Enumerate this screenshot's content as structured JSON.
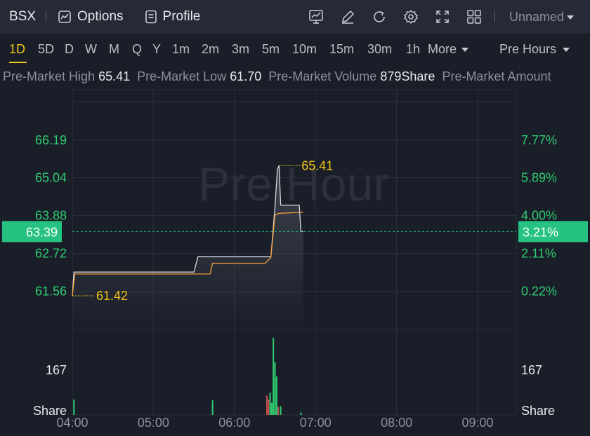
{
  "header": {
    "ticker": "BSX",
    "options_label": "Options",
    "profile_label": "Profile",
    "layout_name": "Unnamed"
  },
  "periods": [
    {
      "label": "1D",
      "active": true
    },
    {
      "label": "5D"
    },
    {
      "label": "D"
    },
    {
      "label": "W"
    },
    {
      "label": "M"
    },
    {
      "label": "Q"
    },
    {
      "label": "Y"
    },
    {
      "label": "1m"
    },
    {
      "label": "2m"
    },
    {
      "label": "3m"
    },
    {
      "label": "5m"
    },
    {
      "label": "10m"
    },
    {
      "label": "15m"
    },
    {
      "label": "30m"
    },
    {
      "label": "1h"
    }
  ],
  "more_label": "More",
  "session_label": "Pre Hours",
  "stats": {
    "high_label": "Pre-Market High",
    "high_value": "65.41",
    "low_label": "Pre-Market Low",
    "low_value": "61.70",
    "volume_label": "Pre-Market Volume",
    "volume_value": "879",
    "volume_unit": "Share",
    "amount_label": "Pre-Market Amount"
  },
  "watermark": "Pre Hour",
  "colors": {
    "up": "#2ecc71",
    "highlight": "#f5c518",
    "price_line": "#d8dce3",
    "avg_line": "#f39c3a",
    "badge": "#26c281"
  },
  "chart_data": {
    "type": "line",
    "x_ticks": [
      "04:00",
      "05:00",
      "06:00",
      "07:00",
      "08:00",
      "09:00"
    ],
    "price_ticks": [
      "66.19",
      "65.04",
      "63.88",
      "62.72",
      "61.56"
    ],
    "price_tick_values": [
      66.19,
      65.04,
      63.88,
      62.72,
      61.56
    ],
    "percent_ticks": [
      "7.77%",
      "5.89%",
      "4.00%",
      "2.11%",
      "0.22%"
    ],
    "current_price": "63.39",
    "current_percent": "3.21%",
    "high_marker": "65.41",
    "low_marker": "61.42",
    "volume_tick": "167",
    "volume_unit": "Share",
    "price_series": [
      {
        "t": 4.0,
        "v": 61.42
      },
      {
        "t": 4.02,
        "v": 62.15
      },
      {
        "t": 5.5,
        "v": 62.15
      },
      {
        "t": 5.55,
        "v": 62.62
      },
      {
        "t": 6.45,
        "v": 62.62
      },
      {
        "t": 6.5,
        "v": 64.15
      },
      {
        "t": 6.53,
        "v": 65.3
      },
      {
        "t": 6.55,
        "v": 65.41
      },
      {
        "t": 6.57,
        "v": 64.2
      },
      {
        "t": 6.8,
        "v": 64.2
      },
      {
        "t": 6.82,
        "v": 63.39
      },
      {
        "t": 6.85,
        "v": 63.39
      }
    ],
    "avg_series": [
      {
        "t": 4.0,
        "v": 61.42
      },
      {
        "t": 4.03,
        "v": 62.09
      },
      {
        "t": 5.7,
        "v": 62.09
      },
      {
        "t": 5.73,
        "v": 62.42
      },
      {
        "t": 6.38,
        "v": 62.42
      },
      {
        "t": 6.45,
        "v": 62.6
      },
      {
        "t": 6.5,
        "v": 63.9
      },
      {
        "t": 6.55,
        "v": 63.95
      },
      {
        "t": 6.85,
        "v": 63.98
      }
    ],
    "volume": [
      {
        "t": 4.02,
        "v": 38,
        "c": "up"
      },
      {
        "t": 5.73,
        "v": 36,
        "c": "up"
      },
      {
        "t": 6.4,
        "v": 48,
        "c": "down"
      },
      {
        "t": 6.42,
        "v": 38,
        "c": "down"
      },
      {
        "t": 6.44,
        "v": 55,
        "c": "up"
      },
      {
        "t": 6.46,
        "v": 30,
        "c": "up"
      },
      {
        "t": 6.48,
        "v": 190,
        "c": "up"
      },
      {
        "t": 6.5,
        "v": 130,
        "c": "up"
      },
      {
        "t": 6.52,
        "v": 95,
        "c": "up"
      },
      {
        "t": 6.54,
        "v": 20,
        "c": "down"
      },
      {
        "t": 6.57,
        "v": 22,
        "c": "up"
      },
      {
        "t": 6.82,
        "v": 6,
        "c": "up"
      }
    ]
  }
}
